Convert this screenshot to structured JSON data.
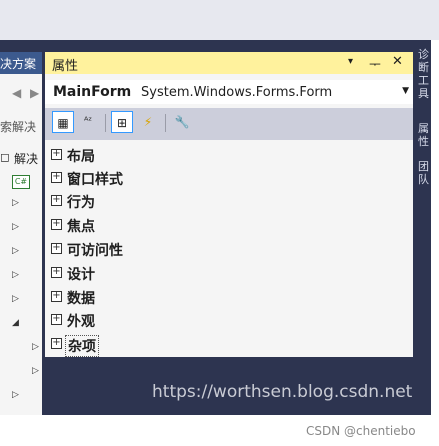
{
  "left_panel": {
    "header": "决方案",
    "search_text": "索解决",
    "solution_item": "解决",
    "project_badge": "C#"
  },
  "right_strip": {
    "text_top": "诊断工具",
    "text_mid": "属性",
    "text_bottom": "团队"
  },
  "properties": {
    "title": "属性",
    "controls": {
      "dropdown": "▾",
      "pin": "ᅮ",
      "close": "✕"
    },
    "object_name": "MainForm",
    "object_type": "System.Windows.Forms.Form",
    "toolbar": {
      "categorized_icon": "▦",
      "alphabetical_icon": "ᴬᶻ",
      "properties_icon": "⊞",
      "events_icon": "⚡",
      "property_pages_icon": "🔧"
    },
    "categories": [
      "布局",
      "窗口样式",
      "行为",
      "焦点",
      "可访问性",
      "设计",
      "数据",
      "外观",
      "杂项"
    ],
    "expand_glyph": "+"
  },
  "watermark": "https://worthsen.blog.csdn.net",
  "credit": "CSDN @chentiebo"
}
